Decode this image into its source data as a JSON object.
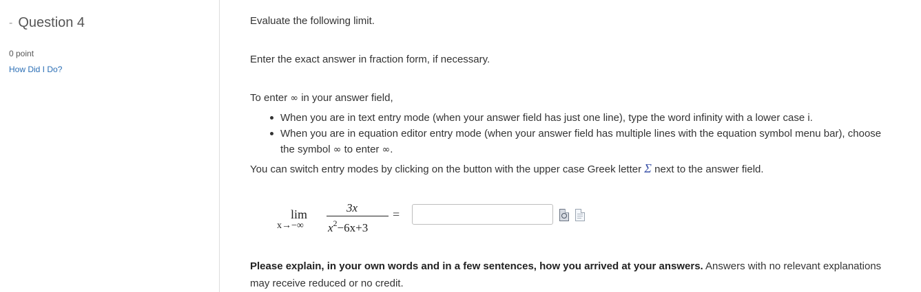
{
  "sidebar": {
    "collapse_symbol": "-",
    "question_title": "Question 4",
    "points": "0 point",
    "how_link": "How Did I Do?"
  },
  "main": {
    "instruction": "Evaluate the following limit.",
    "fraction_note": "Enter the exact answer in fraction form, if necessary.",
    "infinity_intro_a": "To enter",
    "infinity_symbol": "∞",
    "infinity_intro_b": "in your answer field,",
    "bullet1": "When you are in text entry mode (when your answer field has just one line), type the word infinity with a lower case i.",
    "bullet2_a": "When you are in equation editor entry mode (when your answer field has multiple lines with the equation symbol menu bar), choose the symbol",
    "bullet2_b": "to enter",
    "bullet2_end": ".",
    "switch_a": "You can switch entry modes by clicking on the button with the upper case Greek letter",
    "sigma_symbol": "Σ",
    "switch_b": "next to the answer field."
  },
  "math": {
    "lim": "lim",
    "subscript": "x→−∞",
    "numerator": "3x",
    "den_x": "x",
    "den_exp": "2",
    "den_rest": "−6x+3",
    "equals": "="
  },
  "answer": {
    "value": "",
    "placeholder": ""
  },
  "icons": [
    "formula-editor-icon",
    "text-entry-icon"
  ],
  "explanation": {
    "bold": "Please explain, in your own words and in a few sentences, how you arrived at your answers.",
    "rest": "Answers with no relevant explanations may receive reduced or no credit."
  },
  "colors": {
    "link": "#2a6eb5",
    "sigma": "#3a52a8",
    "divider": "#dcdcdc"
  }
}
